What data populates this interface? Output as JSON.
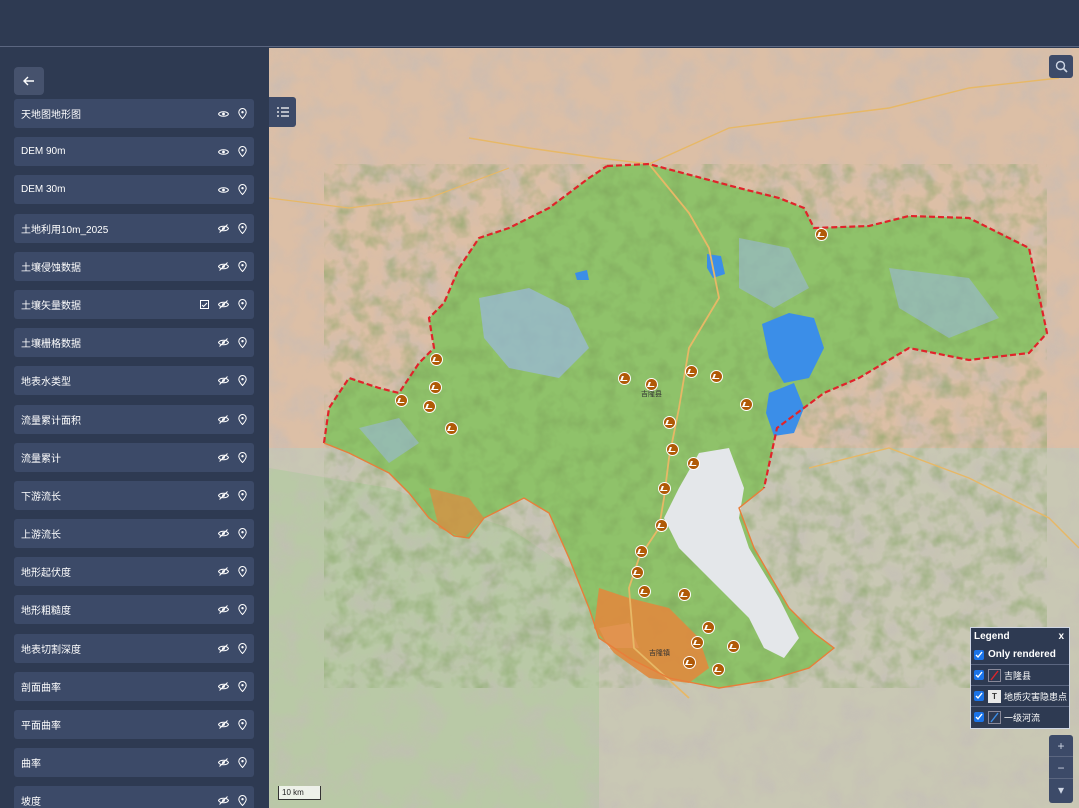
{
  "layers": [
    {
      "label": "天地图地形图",
      "visible": true
    },
    {
      "label": "DEM 90m",
      "visible": true
    },
    {
      "label": "DEM 30m",
      "visible": true
    },
    {
      "label": "土地利用10m_2025",
      "visible": false
    },
    {
      "label": "土壤侵蚀数据",
      "visible": false
    },
    {
      "label": "土壤矢量数据",
      "visible": false,
      "has_table": true
    },
    {
      "label": "土壤栅格数据",
      "visible": false
    },
    {
      "label": "地表水类型",
      "visible": false
    },
    {
      "label": "流量累计面积",
      "visible": false
    },
    {
      "label": "流量累计",
      "visible": false
    },
    {
      "label": "下游流长",
      "visible": false
    },
    {
      "label": "上游流长",
      "visible": false
    },
    {
      "label": "地形起伏度",
      "visible": false
    },
    {
      "label": "地形粗糙度",
      "visible": false
    },
    {
      "label": "地表切割深度",
      "visible": false
    },
    {
      "label": "剖面曲率",
      "visible": false
    },
    {
      "label": "平面曲率",
      "visible": false
    },
    {
      "label": "曲率",
      "visible": false
    },
    {
      "label": "坡度",
      "visible": false
    }
  ],
  "legend": {
    "title": "Legend",
    "close": "x",
    "only_rendered": "Only rendered",
    "items": [
      {
        "label": "吉隆县",
        "symbol": "line-red"
      },
      {
        "label": "地质灾害隐患点",
        "symbol": "T"
      },
      {
        "label": "一级河流",
        "symbol": "line-blue"
      }
    ]
  },
  "map": {
    "scale_label": "10 km",
    "zoom_in": "+",
    "zoom_out": "−",
    "compass": "▾",
    "place_labels": [
      {
        "text": "吉隆县"
      },
      {
        "text": "吉隆镇"
      }
    ]
  },
  "colors": {
    "boundary": "#e0242a",
    "river": "#3b8ee8",
    "hazard": "#b05a07",
    "panel": "#2e3a52",
    "item": "#3c4a68"
  }
}
